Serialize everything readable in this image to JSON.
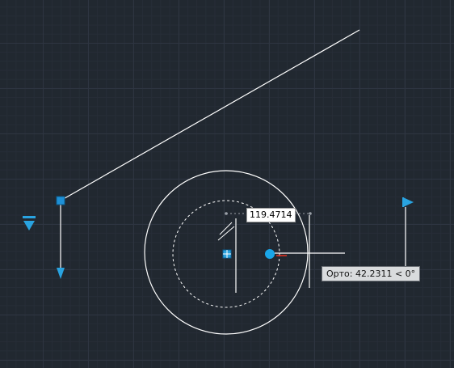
{
  "viewport": {
    "background_color": "#212830",
    "grid_major_color": "#2e3541",
    "grid_minor_color": "#262d37"
  },
  "colors": {
    "geometry": "#ffffff",
    "grip": "#1e90d6",
    "grip_arrow": "#29a3e0",
    "track_point": "#e03020"
  },
  "dynamic_input": {
    "value": "119.4714"
  },
  "tooltip": {
    "text": "Орто: 42.2311 < 0°"
  },
  "icons": {
    "left_arrow_grip": "down-triangle-grip-icon",
    "flag_grip": "flag-grip-icon",
    "square_grip": "square-grip-icon",
    "center_grip": "center-square-grip-icon",
    "cursor_grip": "round-grip-icon"
  }
}
